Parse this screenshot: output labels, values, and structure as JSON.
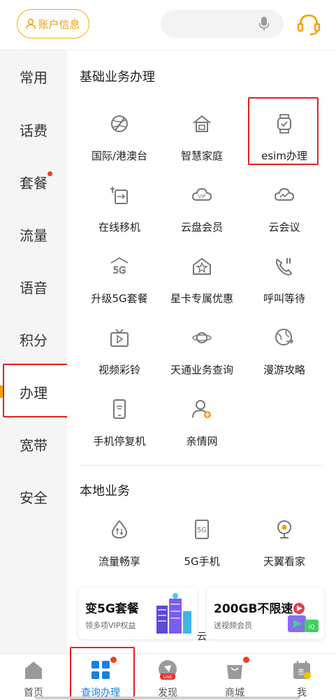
{
  "header": {
    "account_label": "账户信息",
    "search_placeholder": ""
  },
  "sidebar": {
    "items": [
      {
        "label": "常用"
      },
      {
        "label": "话费"
      },
      {
        "label": "套餐",
        "badge": "dot"
      },
      {
        "label": "流量"
      },
      {
        "label": "语音"
      },
      {
        "label": "积分"
      },
      {
        "label": "办理",
        "active": true
      },
      {
        "label": "宽带"
      },
      {
        "label": "安全"
      }
    ]
  },
  "main": {
    "section1_title": "基础业务办理",
    "section1_items": [
      {
        "label": "国际/港澳台",
        "icon": "globe-plane-icon"
      },
      {
        "label": "智慧家庭",
        "icon": "house-icon"
      },
      {
        "label": "esim办理",
        "icon": "smartwatch-icon"
      },
      {
        "label": "在线移机",
        "icon": "transfer-phone-icon"
      },
      {
        "label": "云盘会员",
        "icon": "cloud-vip-icon"
      },
      {
        "label": "云会议",
        "icon": "cloud-meeting-icon"
      },
      {
        "label": "升级5G套餐",
        "icon": "5g-upgrade-icon"
      },
      {
        "label": "星卡专属优惠",
        "icon": "star-home-icon"
      },
      {
        "label": "呼叫等待",
        "icon": "call-wait-icon"
      },
      {
        "label": "视频彩铃",
        "icon": "video-tv-icon"
      },
      {
        "label": "天通业务查询",
        "icon": "satellite-icon"
      },
      {
        "label": "漫游攻略",
        "icon": "roaming-globe-icon"
      },
      {
        "label": "手机停复机",
        "icon": "phone-wifi-icon"
      },
      {
        "label": "亲情网",
        "icon": "family-add-icon"
      }
    ],
    "section2_title": "本地业务",
    "section2_items": [
      {
        "label": "流量畅享",
        "icon": "data-drop-icon"
      },
      {
        "label": "5G手机",
        "icon": "5g-phone-icon"
      },
      {
        "label": "天翼看家",
        "icon": "camera-icon"
      }
    ],
    "promos": [
      {
        "title": "变5G套餐",
        "subtitle": "领多项VIP权益"
      },
      {
        "title": "200GB不限速",
        "subtitle": "送视频会员"
      }
    ],
    "promo_overflow_char": "云"
  },
  "bottom_nav": [
    {
      "label": "首页",
      "icon": "home-icon"
    },
    {
      "label": "查询办理",
      "icon": "grid-apps-icon",
      "active": true,
      "badge": "dot"
    },
    {
      "label": "发现",
      "icon": "live-discover-icon"
    },
    {
      "label": "商城",
      "icon": "shopping-bag-icon",
      "badge": "dot"
    },
    {
      "label": "我",
      "icon": "sign-calendar-icon"
    }
  ],
  "colors": {
    "accent": "#f5a000",
    "icon_gray": "#777777",
    "nav_active": "#1a7fe0",
    "highlight_box": "#e02020",
    "badge_red": "#f04020"
  }
}
